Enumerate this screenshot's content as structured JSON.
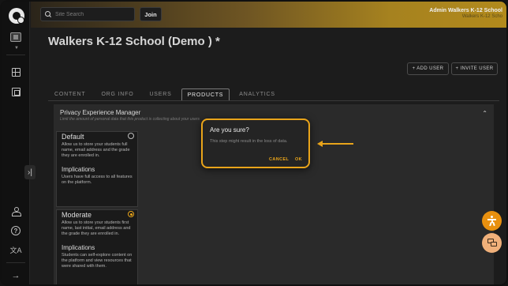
{
  "header": {
    "search_placeholder": "Site Search",
    "join_label": "Join",
    "user_name": "Admin Walkers K-12 School",
    "user_sub": "Walkers K-12 Scho"
  },
  "page": {
    "title": "Walkers K-12 School (Demo ) *",
    "add_user_label": "+ ADD USER",
    "invite_user_label": "+ INVITE USER"
  },
  "tabs": [
    {
      "label": "CONTENT"
    },
    {
      "label": "ORG INFO"
    },
    {
      "label": "USERS"
    },
    {
      "label": "PRODUCTS",
      "active": true
    },
    {
      "label": "ANALYTICS"
    }
  ],
  "panel": {
    "title": "Privacy Experience Manager",
    "subtitle": "Limit the amount of personal data that this product is collecting about your users"
  },
  "options": [
    {
      "title": "Default",
      "description": "Allow us to store your students full name, email address and the grade they are enrolled in.",
      "impl_title": "Implications",
      "impl_text": "Users have full access to all features on the platform.",
      "selected": false
    },
    {
      "title": "Moderate",
      "description": "Allow us to store your students first name, last initial, email address and the grade they are enrolled in.",
      "impl_title": "Implications",
      "impl_text": "Students can self-explore content on the platform and view resources that were shared with them.",
      "selected": true
    }
  ],
  "dialog": {
    "title": "Are you sure?",
    "message": "This step might result in the loss of data.",
    "cancel_label": "CANCEL",
    "ok_label": "OK"
  },
  "sidebar": {
    "language_glyph": "文A",
    "help_glyph": "?",
    "expand_glyph": "›|",
    "logout_glyph": "→"
  },
  "colors": {
    "accent": "#e9a41a",
    "header_gradient_end": "#b28a1c"
  }
}
